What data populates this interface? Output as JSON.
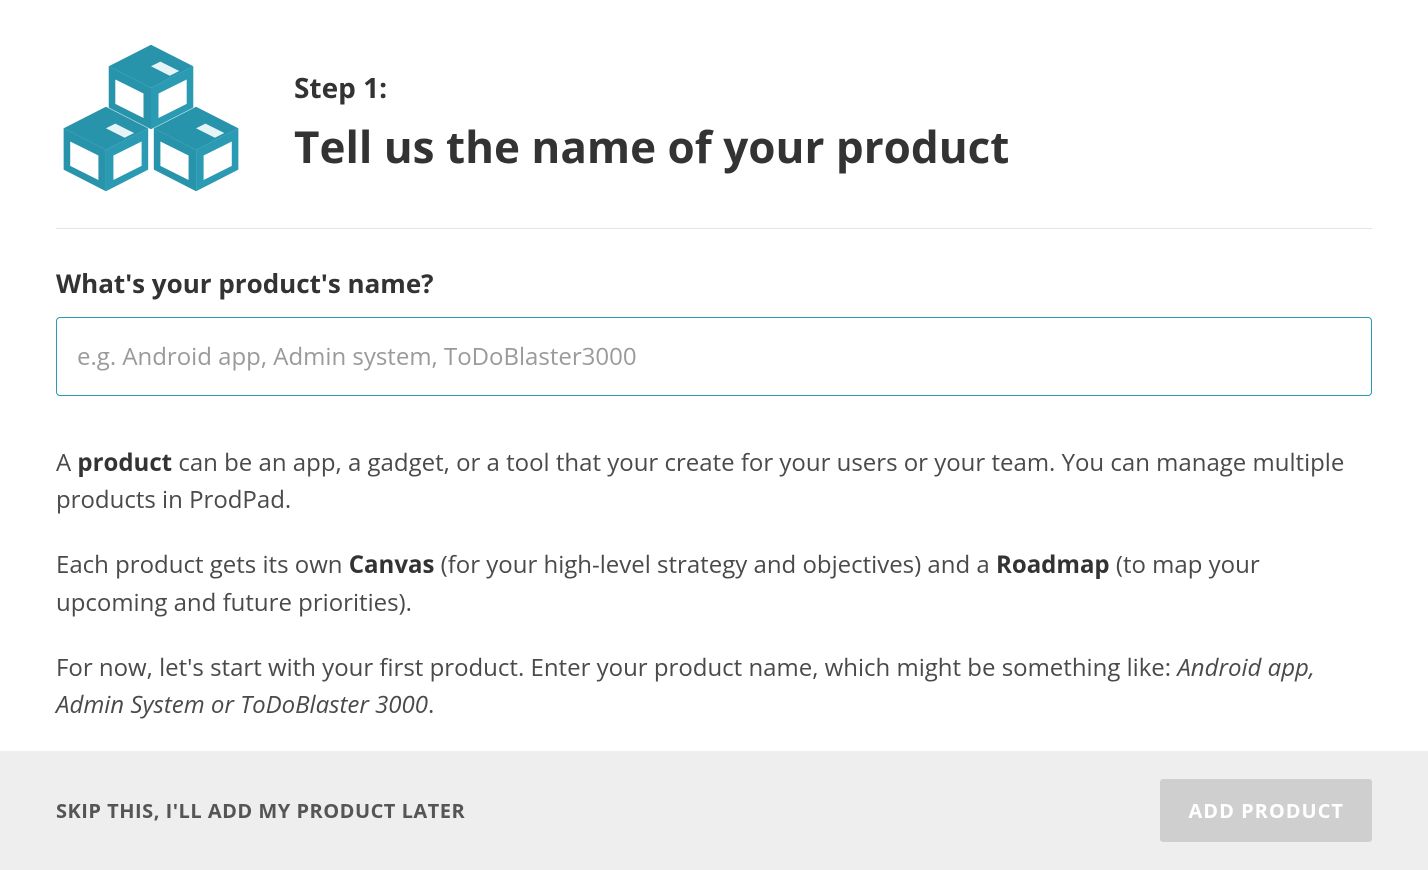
{
  "header": {
    "step_label": "Step 1:",
    "title": "Tell us the name of your product"
  },
  "form": {
    "field_label": "What's your product's name?",
    "placeholder": "e.g. Android app, Admin system, ToDoBlaster3000",
    "value": ""
  },
  "description": {
    "p1_prefix": "A ",
    "p1_bold": "product",
    "p1_rest": " can be an app, a gadget, or a tool that your create for your users or your team. You can manage multiple products in ProdPad.",
    "p2_prefix": "Each product gets its own ",
    "p2_bold1": "Canvas",
    "p2_mid": " (for your high-level strategy and objectives) and a ",
    "p2_bold2": "Roadmap",
    "p2_rest": " (to map your upcoming and future priorities).",
    "p3_prefix": "For now, let's start with your first product. Enter your product name, which might be something like: ",
    "p3_italic": "Android app, Admin System or ToDoBlaster 3000",
    "p3_suffix": "."
  },
  "footer": {
    "skip_label": "SKIP THIS, I'LL ADD MY PRODUCT LATER",
    "add_button_label": "ADD PRODUCT"
  },
  "colors": {
    "accent": "#2a9bb3"
  }
}
